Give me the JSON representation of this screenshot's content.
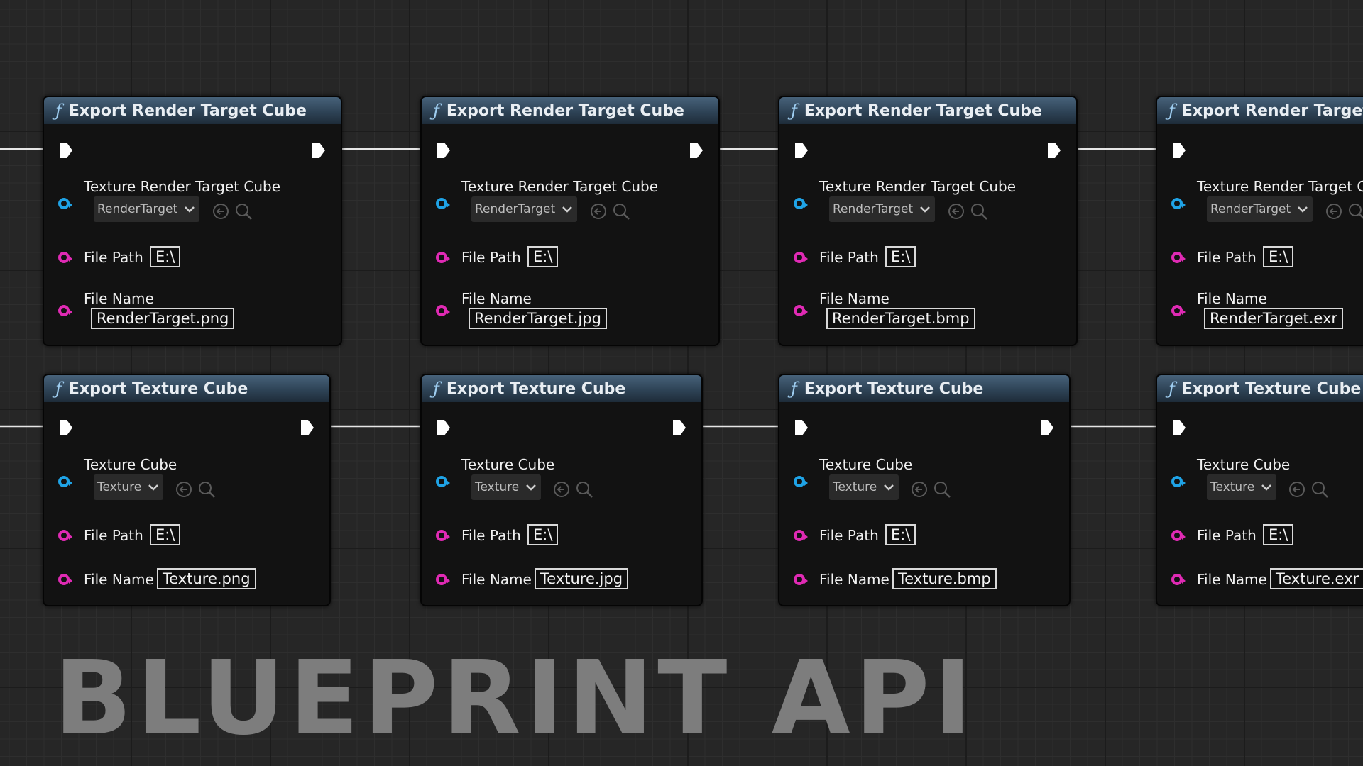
{
  "nodes_top": [
    {
      "title": "Export Render Target Cube",
      "object_label": "Texture Render Target Cube",
      "object_value": "RenderTarget",
      "path_label": "File Path",
      "path_value": "E:\\",
      "name_label": "File Name",
      "name_value": "RenderTarget.png"
    },
    {
      "title": "Export Render Target Cube",
      "object_label": "Texture Render Target Cube",
      "object_value": "RenderTarget",
      "path_label": "File Path",
      "path_value": "E:\\",
      "name_label": "File Name",
      "name_value": "RenderTarget.jpg"
    },
    {
      "title": "Export Render Target Cube",
      "object_label": "Texture Render Target Cube",
      "object_value": "RenderTarget",
      "path_label": "File Path",
      "path_value": "E:\\",
      "name_label": "File Name",
      "name_value": "RenderTarget.bmp"
    },
    {
      "title": "Export Render Target Cube",
      "object_label": "Texture Render Target Cube",
      "object_value": "RenderTarget",
      "path_label": "File Path",
      "path_value": "E:\\",
      "name_label": "File Name",
      "name_value": "RenderTarget.exr"
    }
  ],
  "nodes_bottom": [
    {
      "title": "Export Texture Cube",
      "object_label": "Texture Cube",
      "object_value": "Texture",
      "path_label": "File Path",
      "path_value": "E:\\",
      "name_label": "File Name",
      "name_value": "Texture.png"
    },
    {
      "title": "Export Texture Cube",
      "object_label": "Texture Cube",
      "object_value": "Texture",
      "path_label": "File Path",
      "path_value": "E:\\",
      "name_label": "File Name",
      "name_value": "Texture.jpg"
    },
    {
      "title": "Export Texture Cube",
      "object_label": "Texture Cube",
      "object_value": "Texture",
      "path_label": "File Path",
      "path_value": "E:\\",
      "name_label": "File Name",
      "name_value": "Texture.bmp"
    },
    {
      "title": "Export Texture Cube",
      "object_label": "Texture Cube",
      "object_value": "Texture",
      "path_label": "File Path",
      "path_value": "E:\\",
      "name_label": "File Name",
      "name_value": "Texture.exr"
    }
  ],
  "watermark": "BLUEPRINT API",
  "colors": {
    "object_pin": "#1fa3e6",
    "string_pin": "#e02ab4",
    "exec_pin": "#ffffff",
    "header": "#2e4356"
  },
  "icons": {
    "function": "function-icon",
    "exec": "exec-pin-icon",
    "browse": "browse-arrow-icon",
    "search": "search-icon",
    "dropdown": "chevron-down-icon"
  }
}
